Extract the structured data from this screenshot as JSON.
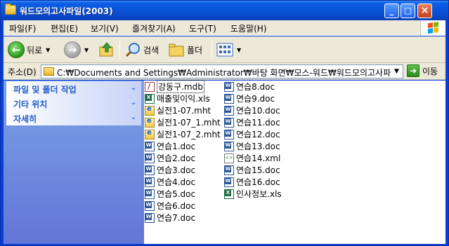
{
  "window": {
    "title": "워드모의고사파일(2003)"
  },
  "title_buttons": {
    "minimize": "_",
    "maximize": "□",
    "close": "×"
  },
  "menu": [
    "파일(F)",
    "편집(E)",
    "보기(V)",
    "즐겨찾기(A)",
    "도구(T)",
    "도움말(H)"
  ],
  "toolbar": {
    "back": "뒤로",
    "search": "검색",
    "folders": "폴더"
  },
  "address": {
    "label": "주소(D)",
    "path": "C:₩Documents and Settings₩Administrator₩바탕 화면₩모스-워드₩워드모의고사파일",
    "go": "이동"
  },
  "taskpane": {
    "sections": [
      "파일 및 폴더 작업",
      "기타 위치",
      "자세히"
    ]
  },
  "files": {
    "col1": [
      {
        "name": "강동구.mdb",
        "icon": "mdb-icon",
        "selected": true
      },
      {
        "name": "매출및이익.xls",
        "icon": "xls-icon"
      },
      {
        "name": "실전1-07.mht",
        "icon": "mht-icon"
      },
      {
        "name": "실전1-07_1.mht",
        "icon": "mht-icon"
      },
      {
        "name": "실전1-07_2.mht",
        "icon": "mht-icon"
      },
      {
        "name": "연습1.doc",
        "icon": "doc-icon"
      },
      {
        "name": "연습2.doc",
        "icon": "doc-icon"
      },
      {
        "name": "연습3.doc",
        "icon": "doc-icon"
      },
      {
        "name": "연습4.doc",
        "icon": "doc-icon"
      },
      {
        "name": "연습5.doc",
        "icon": "doc-icon"
      },
      {
        "name": "연습6.doc",
        "icon": "doc-icon"
      },
      {
        "name": "연습7.doc",
        "icon": "doc-icon"
      }
    ],
    "col2": [
      {
        "name": "연습8.doc",
        "icon": "doc-icon"
      },
      {
        "name": "연습9.doc",
        "icon": "doc-icon"
      },
      {
        "name": "연습10.doc",
        "icon": "doc-icon"
      },
      {
        "name": "연습11.doc",
        "icon": "doc-icon"
      },
      {
        "name": "연습12.doc",
        "icon": "doc-icon"
      },
      {
        "name": "연습13.doc",
        "icon": "doc-icon"
      },
      {
        "name": "연습14.xml",
        "icon": "xml-icon"
      },
      {
        "name": "연습15.doc",
        "icon": "doc-icon"
      },
      {
        "name": "연습16.doc",
        "icon": "doc-icon"
      },
      {
        "name": "인사정보.xls",
        "icon": "xls-icon"
      }
    ]
  }
}
